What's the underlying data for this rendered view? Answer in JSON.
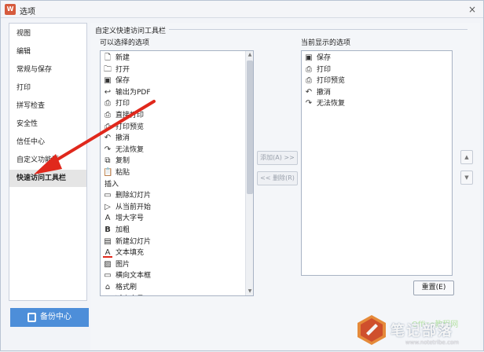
{
  "window": {
    "title": "选项",
    "close_glyph": "×",
    "logo_text": "W"
  },
  "sidebar": {
    "items": [
      {
        "label": "视图",
        "active": false
      },
      {
        "label": "编辑",
        "active": false
      },
      {
        "label": "常规与保存",
        "active": false
      },
      {
        "label": "打印",
        "active": false
      },
      {
        "label": "拼写检查",
        "active": false
      },
      {
        "label": "安全性",
        "active": false
      },
      {
        "label": "信任中心",
        "active": false
      },
      {
        "label": "自定义功能区",
        "active": false
      },
      {
        "label": "快速访问工具栏",
        "active": true
      }
    ]
  },
  "backup": {
    "label": "备份中心"
  },
  "panel": {
    "group_title": "自定义快速访问工具栏",
    "available_label": "可以选择的选项",
    "current_label": "当前显示的选项",
    "add_button": "添加(A) >>",
    "remove_button": "<< 删除(R)",
    "up_glyph": "▲",
    "down_glyph": "▼",
    "reset_button": "重置(E)"
  },
  "available_items": [
    {
      "icon": "new-doc-icon",
      "glyph": "🗋",
      "label": "新建"
    },
    {
      "icon": "open-folder-icon",
      "glyph": "🗀",
      "label": "打开"
    },
    {
      "icon": "save-icon",
      "glyph": "▣",
      "label": "保存"
    },
    {
      "icon": "export-pdf-icon",
      "glyph": "↩",
      "label": "输出为PDF"
    },
    {
      "icon": "print-icon",
      "glyph": "⎙",
      "label": "打印"
    },
    {
      "icon": "direct-print-icon",
      "glyph": "⎙",
      "label": "直接打印"
    },
    {
      "icon": "print-preview-icon",
      "glyph": "⎙",
      "label": "打印预览"
    },
    {
      "icon": "undo-icon",
      "glyph": "↶",
      "label": "撤消"
    },
    {
      "icon": "redo-icon",
      "glyph": "↷",
      "label": "无法恢复"
    },
    {
      "icon": "copy-icon",
      "glyph": "⧉",
      "label": "复制"
    },
    {
      "icon": "paste-icon",
      "glyph": "📋",
      "label": "粘贴"
    },
    {
      "icon": "",
      "glyph": "",
      "label": "插入",
      "header": true
    },
    {
      "icon": "delete-slide-icon",
      "glyph": "▭",
      "label": "删除幻灯片"
    },
    {
      "icon": "play-from-current-icon",
      "glyph": "▷",
      "label": "从当前开始"
    },
    {
      "icon": "increase-font-icon",
      "glyph": "A",
      "label": "增大字号"
    },
    {
      "icon": "bold-icon",
      "glyph": "B",
      "label": "加粗"
    },
    {
      "icon": "new-slide-icon",
      "glyph": "▤",
      "label": "新建幻灯片"
    },
    {
      "icon": "text-fill-icon",
      "glyph": "A",
      "label": "文本填充"
    },
    {
      "icon": "picture-icon",
      "glyph": "▨",
      "label": "图片"
    },
    {
      "icon": "horizontal-textbox-icon",
      "glyph": "▭",
      "label": "横向文本框"
    },
    {
      "icon": "format-painter-icon",
      "glyph": "⌂",
      "label": "格式刷"
    },
    {
      "icon": "decrease-font-icon",
      "glyph": "A",
      "label": "减小字号"
    }
  ],
  "current_items": [
    {
      "icon": "save-icon",
      "glyph": "▣",
      "label": "保存"
    },
    {
      "icon": "print-icon",
      "glyph": "⎙",
      "label": "打印"
    },
    {
      "icon": "print-preview-icon",
      "glyph": "⎙",
      "label": "打印预览"
    },
    {
      "icon": "undo-icon",
      "glyph": "↶",
      "label": "撤消"
    },
    {
      "icon": "redo-icon",
      "glyph": "↷",
      "label": "无法恢复"
    }
  ],
  "watermark": {
    "main": "笔记部落",
    "sub": "Office教程网",
    "url": "www.notetribe.com"
  },
  "colors": {
    "accent": "#4d8ed9",
    "arrow": "#e0281c",
    "active_item": "#e5e5e5"
  }
}
